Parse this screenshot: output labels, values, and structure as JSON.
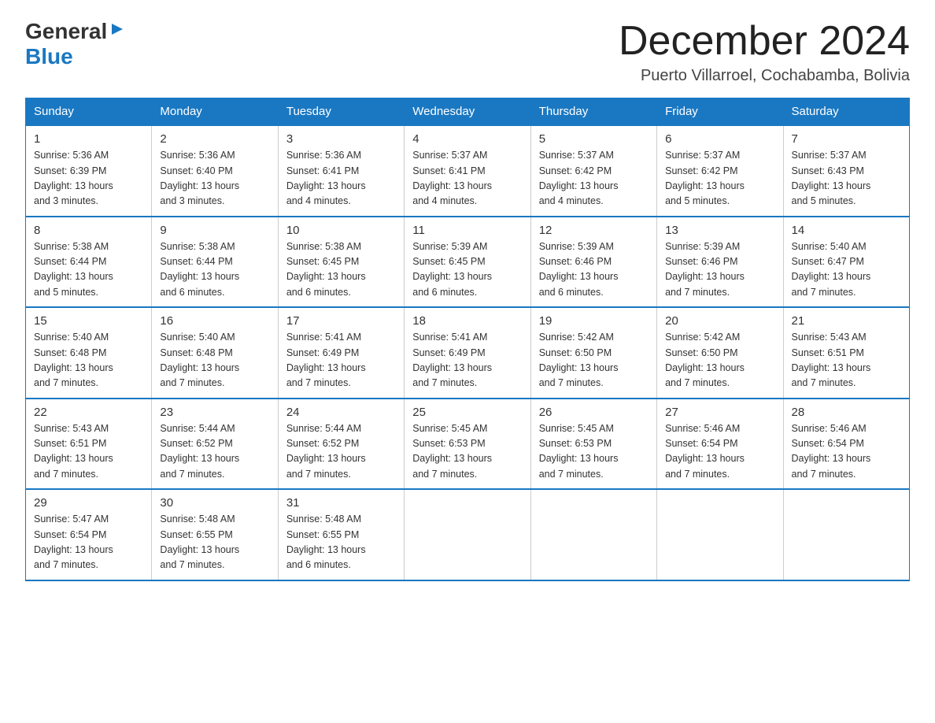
{
  "logo": {
    "general": "General",
    "blue": "Blue",
    "triangle": "▶"
  },
  "title": {
    "month_year": "December 2024",
    "location": "Puerto Villarroel, Cochabamba, Bolivia"
  },
  "weekdays": [
    "Sunday",
    "Monday",
    "Tuesday",
    "Wednesday",
    "Thursday",
    "Friday",
    "Saturday"
  ],
  "weeks": [
    [
      {
        "day": "1",
        "sunrise": "5:36 AM",
        "sunset": "6:39 PM",
        "daylight": "13 hours and 3 minutes."
      },
      {
        "day": "2",
        "sunrise": "5:36 AM",
        "sunset": "6:40 PM",
        "daylight": "13 hours and 3 minutes."
      },
      {
        "day": "3",
        "sunrise": "5:36 AM",
        "sunset": "6:41 PM",
        "daylight": "13 hours and 4 minutes."
      },
      {
        "day": "4",
        "sunrise": "5:37 AM",
        "sunset": "6:41 PM",
        "daylight": "13 hours and 4 minutes."
      },
      {
        "day": "5",
        "sunrise": "5:37 AM",
        "sunset": "6:42 PM",
        "daylight": "13 hours and 4 minutes."
      },
      {
        "day": "6",
        "sunrise": "5:37 AM",
        "sunset": "6:42 PM",
        "daylight": "13 hours and 5 minutes."
      },
      {
        "day": "7",
        "sunrise": "5:37 AM",
        "sunset": "6:43 PM",
        "daylight": "13 hours and 5 minutes."
      }
    ],
    [
      {
        "day": "8",
        "sunrise": "5:38 AM",
        "sunset": "6:44 PM",
        "daylight": "13 hours and 5 minutes."
      },
      {
        "day": "9",
        "sunrise": "5:38 AM",
        "sunset": "6:44 PM",
        "daylight": "13 hours and 6 minutes."
      },
      {
        "day": "10",
        "sunrise": "5:38 AM",
        "sunset": "6:45 PM",
        "daylight": "13 hours and 6 minutes."
      },
      {
        "day": "11",
        "sunrise": "5:39 AM",
        "sunset": "6:45 PM",
        "daylight": "13 hours and 6 minutes."
      },
      {
        "day": "12",
        "sunrise": "5:39 AM",
        "sunset": "6:46 PM",
        "daylight": "13 hours and 6 minutes."
      },
      {
        "day": "13",
        "sunrise": "5:39 AM",
        "sunset": "6:46 PM",
        "daylight": "13 hours and 7 minutes."
      },
      {
        "day": "14",
        "sunrise": "5:40 AM",
        "sunset": "6:47 PM",
        "daylight": "13 hours and 7 minutes."
      }
    ],
    [
      {
        "day": "15",
        "sunrise": "5:40 AM",
        "sunset": "6:48 PM",
        "daylight": "13 hours and 7 minutes."
      },
      {
        "day": "16",
        "sunrise": "5:40 AM",
        "sunset": "6:48 PM",
        "daylight": "13 hours and 7 minutes."
      },
      {
        "day": "17",
        "sunrise": "5:41 AM",
        "sunset": "6:49 PM",
        "daylight": "13 hours and 7 minutes."
      },
      {
        "day": "18",
        "sunrise": "5:41 AM",
        "sunset": "6:49 PM",
        "daylight": "13 hours and 7 minutes."
      },
      {
        "day": "19",
        "sunrise": "5:42 AM",
        "sunset": "6:50 PM",
        "daylight": "13 hours and 7 minutes."
      },
      {
        "day": "20",
        "sunrise": "5:42 AM",
        "sunset": "6:50 PM",
        "daylight": "13 hours and 7 minutes."
      },
      {
        "day": "21",
        "sunrise": "5:43 AM",
        "sunset": "6:51 PM",
        "daylight": "13 hours and 7 minutes."
      }
    ],
    [
      {
        "day": "22",
        "sunrise": "5:43 AM",
        "sunset": "6:51 PM",
        "daylight": "13 hours and 7 minutes."
      },
      {
        "day": "23",
        "sunrise": "5:44 AM",
        "sunset": "6:52 PM",
        "daylight": "13 hours and 7 minutes."
      },
      {
        "day": "24",
        "sunrise": "5:44 AM",
        "sunset": "6:52 PM",
        "daylight": "13 hours and 7 minutes."
      },
      {
        "day": "25",
        "sunrise": "5:45 AM",
        "sunset": "6:53 PM",
        "daylight": "13 hours and 7 minutes."
      },
      {
        "day": "26",
        "sunrise": "5:45 AM",
        "sunset": "6:53 PM",
        "daylight": "13 hours and 7 minutes."
      },
      {
        "day": "27",
        "sunrise": "5:46 AM",
        "sunset": "6:54 PM",
        "daylight": "13 hours and 7 minutes."
      },
      {
        "day": "28",
        "sunrise": "5:46 AM",
        "sunset": "6:54 PM",
        "daylight": "13 hours and 7 minutes."
      }
    ],
    [
      {
        "day": "29",
        "sunrise": "5:47 AM",
        "sunset": "6:54 PM",
        "daylight": "13 hours and 7 minutes."
      },
      {
        "day": "30",
        "sunrise": "5:48 AM",
        "sunset": "6:55 PM",
        "daylight": "13 hours and 7 minutes."
      },
      {
        "day": "31",
        "sunrise": "5:48 AM",
        "sunset": "6:55 PM",
        "daylight": "13 hours and 6 minutes."
      },
      null,
      null,
      null,
      null
    ]
  ],
  "labels": {
    "sunrise": "Sunrise:",
    "sunset": "Sunset:",
    "daylight": "Daylight:"
  }
}
